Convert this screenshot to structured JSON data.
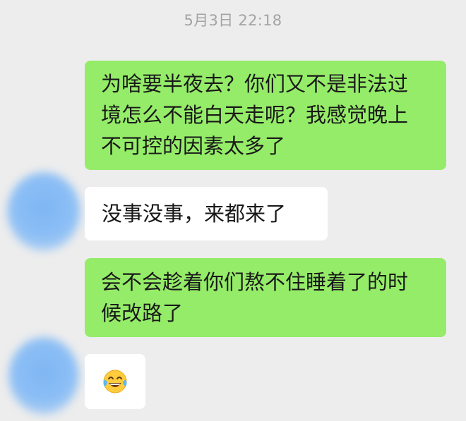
{
  "timestamp": "5月3日 22:18",
  "messages": [
    {
      "direction": "sent",
      "lines": [
        "为啥要半夜去？你们又不是非法过",
        "境怎么不能白天走呢？我感觉晚上",
        "不可控的因素太多了"
      ]
    },
    {
      "direction": "received",
      "lines": [
        "没事没事，来都来了"
      ]
    },
    {
      "direction": "sent",
      "lines": [
        "会不会趁着你们熬不住睡着了的时",
        "候改路了"
      ]
    },
    {
      "direction": "received",
      "emoji": "face-with-tears-of-joy-icon"
    }
  ],
  "colors": {
    "background": "#ededed",
    "sent_bubble": "#95ec69",
    "received_bubble": "#ffffff",
    "timestamp_text": "#a3a3a3"
  },
  "icons": {
    "avatar": "blurred-avatar",
    "emoji": "face-with-tears-of-joy-icon"
  }
}
